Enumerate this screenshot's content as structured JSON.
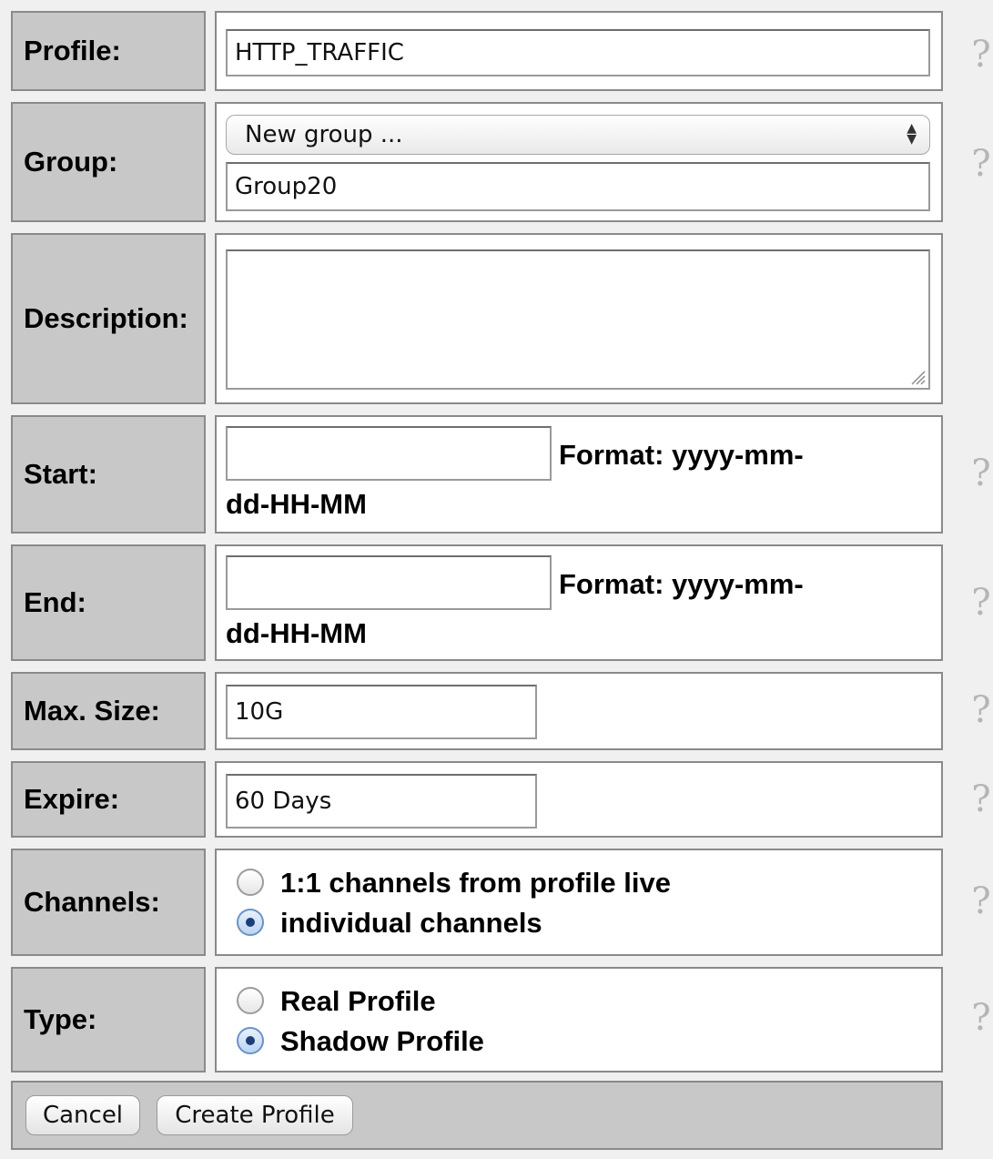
{
  "fields": {
    "profile": {
      "label": "Profile:",
      "value": "HTTP_TRAFFIC"
    },
    "group": {
      "label": "Group:",
      "selected": "New group ...",
      "value": "Group20"
    },
    "description": {
      "label": "Description:",
      "value": ""
    },
    "start": {
      "label": "Start:",
      "value": "",
      "format_line1": "Format: yyyy-mm-",
      "format_line2": "dd-HH-MM"
    },
    "end": {
      "label": "End:",
      "value": "",
      "format_line1": "Format: yyyy-mm-",
      "format_line2": "dd-HH-MM"
    },
    "max_size": {
      "label": "Max. Size:",
      "value": "10G"
    },
    "expire": {
      "label": "Expire:",
      "value": "60 Days"
    },
    "channels": {
      "label": "Channels:",
      "options": [
        {
          "label": "1:1 channels from profile live",
          "selected": false
        },
        {
          "label": "individual channels",
          "selected": true
        }
      ]
    },
    "type": {
      "label": "Type:",
      "options": [
        {
          "label": "Real Profile",
          "selected": false
        },
        {
          "label": "Shadow Profile",
          "selected": true
        }
      ]
    }
  },
  "help_glyph": "?",
  "buttons": {
    "cancel": "Cancel",
    "create": "Create Profile"
  },
  "icons": {
    "help": "help-icon",
    "select_arrows": "select-arrows-icon",
    "resize_grip": "resize-grip-icon"
  }
}
